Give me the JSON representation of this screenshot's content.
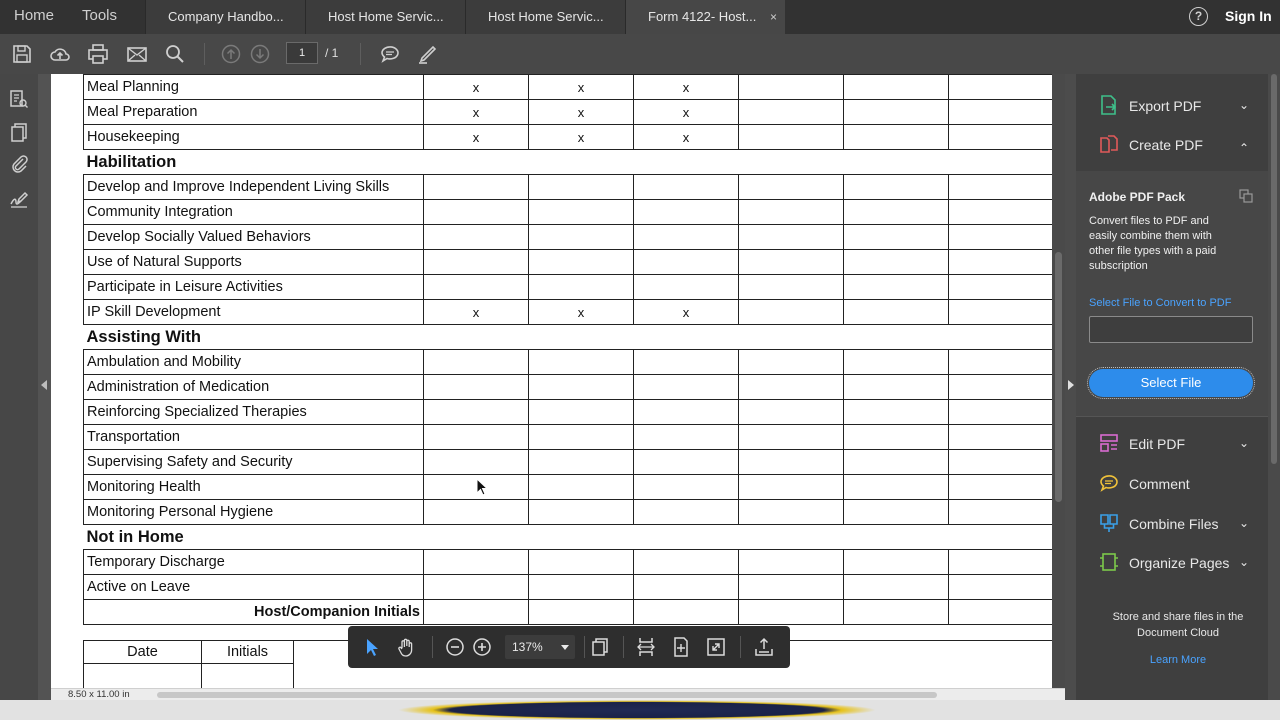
{
  "tabbar": {
    "home": "Home",
    "tools": "Tools",
    "tabs": [
      {
        "label": "Company Handbo..."
      },
      {
        "label": "Host Home Servic..."
      },
      {
        "label": "Host Home Servic..."
      },
      {
        "label": "Form 4122- Host..."
      }
    ],
    "close_glyph": "×",
    "help_glyph": "?",
    "sign_in": "Sign In"
  },
  "toolbar": {
    "page_current": "1",
    "page_total": "/  1",
    "icons": [
      "save-icon",
      "upload-icon",
      "print-icon",
      "mail-icon",
      "search-icon",
      "page-up-icon",
      "page-down-icon",
      "comment-icon",
      "pen-icon"
    ]
  },
  "document": {
    "page_size": "8.50 x 11.00 in",
    "rows": [
      {
        "type": "row",
        "label": "Meal Planning",
        "cols": [
          "x",
          "x",
          "x",
          "",
          "",
          ""
        ]
      },
      {
        "type": "row",
        "label": "Meal Preparation",
        "cols": [
          "x",
          "x",
          "x",
          "",
          "",
          ""
        ]
      },
      {
        "type": "row",
        "label": "Housekeeping",
        "cols": [
          "x",
          "x",
          "x",
          "",
          "",
          ""
        ]
      },
      {
        "type": "section",
        "label": "Habilitation"
      },
      {
        "type": "row",
        "label": "Develop and Improve Independent Living Skills",
        "cols": [
          "",
          "",
          "",
          "",
          "",
          ""
        ]
      },
      {
        "type": "row",
        "label": "Community Integration",
        "cols": [
          "",
          "",
          "",
          "",
          "",
          ""
        ]
      },
      {
        "type": "row",
        "label": "Develop Socially Valued Behaviors",
        "cols": [
          "",
          "",
          "",
          "",
          "",
          ""
        ]
      },
      {
        "type": "row",
        "label": "Use of Natural Supports",
        "cols": [
          "",
          "",
          "",
          "",
          "",
          ""
        ]
      },
      {
        "type": "row",
        "label": "Participate in Leisure Activities",
        "cols": [
          "",
          "",
          "",
          "",
          "",
          ""
        ]
      },
      {
        "type": "row",
        "label": "IP Skill Development",
        "cols": [
          "x",
          "x",
          "x",
          "",
          "",
          ""
        ]
      },
      {
        "type": "section",
        "label": "Assisting With"
      },
      {
        "type": "row",
        "label": "Ambulation and Mobility",
        "cols": [
          "",
          "",
          "",
          "",
          "",
          ""
        ]
      },
      {
        "type": "row",
        "label": "Administration of Medication",
        "cols": [
          "",
          "",
          "",
          "",
          "",
          ""
        ]
      },
      {
        "type": "row",
        "label": "Reinforcing Specialized Therapies",
        "cols": [
          "",
          "",
          "",
          "",
          "",
          ""
        ]
      },
      {
        "type": "row",
        "label": "Transportation",
        "cols": [
          "",
          "",
          "",
          "",
          "",
          ""
        ]
      },
      {
        "type": "row",
        "label": "Supervising Safety and Security",
        "cols": [
          "",
          "",
          "",
          "",
          "",
          ""
        ]
      },
      {
        "type": "row",
        "label": "Monitoring Health",
        "cols": [
          "",
          "",
          "",
          "",
          "",
          ""
        ]
      },
      {
        "type": "row",
        "label": "Monitoring Personal Hygiene",
        "cols": [
          "",
          "",
          "",
          "",
          "",
          ""
        ]
      },
      {
        "type": "section",
        "label": "Not in Home"
      },
      {
        "type": "row",
        "label": "Temporary Discharge",
        "cols": [
          "",
          "",
          "",
          "",
          "",
          ""
        ]
      },
      {
        "type": "row",
        "label": "Active on Leave",
        "cols": [
          "",
          "",
          "",
          "",
          "",
          ""
        ]
      },
      {
        "type": "initials",
        "label": "Host/Companion Initials",
        "cols": [
          "",
          "",
          "",
          "",
          "",
          ""
        ]
      }
    ],
    "sub_table": {
      "date": "Date",
      "initials": "Initials"
    }
  },
  "float_toolbar": {
    "zoom": "137%",
    "icons": [
      "select-arrow-icon",
      "hand-icon",
      "zoom-out-icon",
      "zoom-in-icon",
      "page-view-icon",
      "fit-width-icon",
      "fit-page-icon",
      "full-screen-icon",
      "share-icon"
    ]
  },
  "right_panel": {
    "export_pdf": "Export PDF",
    "create_pdf": "Create PDF",
    "pack_title": "Adobe PDF Pack",
    "pack_desc": "Convert files to PDF and easily combine them with other file types with a paid subscription",
    "select_link": "Select File to Convert to PDF",
    "select_button": "Select File",
    "edit_pdf": "Edit PDF",
    "comment": "Comment",
    "combine_files": "Combine Files",
    "organize_pages": "Organize Pages",
    "cloud_text": "Store and share files in the Document Cloud",
    "learn_more": "Learn More",
    "chevron_down": "⌄",
    "chevron_up": "⌃",
    "colors": {
      "accent_blue": "#2d8ceb",
      "link_blue": "#4aa3ff",
      "export_green": "#3fbf8a",
      "create_red": "#e05a5a",
      "edit_pink": "#d86bd0",
      "comment_yellow": "#f0c23a",
      "combine_blue": "#3aa0e8",
      "organize_green": "#7cc94a"
    }
  }
}
